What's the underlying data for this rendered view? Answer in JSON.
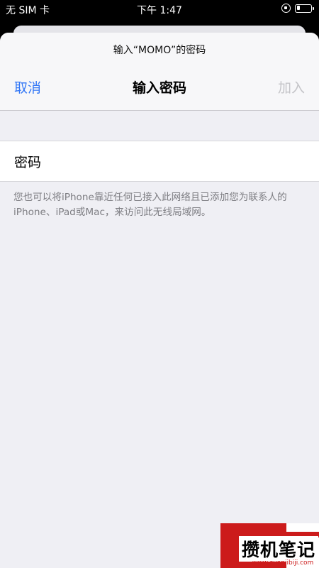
{
  "status_bar": {
    "carrier": "无 SIM 卡",
    "time": "下午 1:47",
    "lock_icon": "orientation-lock-icon",
    "battery_icon": "battery-icon"
  },
  "sheet": {
    "prompt": "输入“MOMO”的密码",
    "cancel_label": "取消",
    "title": "输入密码",
    "join_label": "加入",
    "password_label": "密码",
    "password_value": "",
    "password_placeholder": "",
    "hint": "您也可以将iPhone靠近任何已接入此网络且已添加您为联系人的iPhone、iPad或Mac，来访问此无线局域网。"
  },
  "colors": {
    "accent": "#3478f6",
    "disabled": "#c4c4c8",
    "background": "#efeff4"
  },
  "watermark": {
    "text": "攒机笔记",
    "url": "www.cuanjibiji.com"
  }
}
